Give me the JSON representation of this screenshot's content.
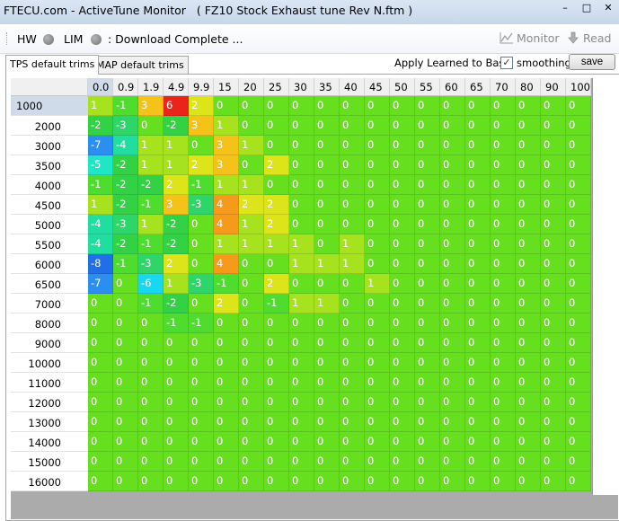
{
  "window": {
    "title": "FTECU.com - ActiveTune Monitor   ( FZ10 Stock Exhaust tune Rev N.ftm )",
    "minimize_glyph": "–",
    "maximize_glyph": "□",
    "close_glyph": "✕"
  },
  "toolbar": {
    "hw_label": "HW",
    "lim_label": "LIM",
    "status_text": ":  Download Complete  ...",
    "monitor_label": "Monitor",
    "read_label": "Read",
    "hw_led_icon": "status-led",
    "lim_led_icon": "status-led",
    "monitor_icon": "chart-line-icon",
    "read_icon": "download-arrow-icon"
  },
  "tabs": [
    {
      "label": "TPS default trims",
      "active": true
    },
    {
      "label": "MAP default trims",
      "active": false
    }
  ],
  "apply_learned_label": "Apply Learned to Base:",
  "smoothing": {
    "label": "smoothing",
    "checked": true,
    "check_glyph": "✓"
  },
  "save_label": "save",
  "colors": {
    "cell_green": "#66e01e",
    "header_selected": "#d0dbe9",
    "scale": {
      "-8": "#1e6fe8",
      "-7": "#2a8ff0",
      "-6": "#17d8f0",
      "-5": "#1fe6c4",
      "-4": "#20dea0",
      "-3": "#2ed66a",
      "-2": "#33d245",
      "-1": "#4edc2e",
      "0": "#66e01e",
      "1": "#a6e31e",
      "2": "#dde41a",
      "3": "#f5c21a",
      "4": "#f59a1a",
      "5": "#f06a1a",
      "6": "#ea2418"
    }
  },
  "table": {
    "columns": [
      "0.0",
      "0.9",
      "1.9",
      "4.9",
      "9.9",
      "15",
      "20",
      "25",
      "30",
      "35",
      "40",
      "45",
      "50",
      "55",
      "60",
      "65",
      "70",
      "80",
      "90",
      "100"
    ],
    "selected_column": 0,
    "selected_row": 0,
    "rows": [
      {
        "label": "1000",
        "values": [
          1,
          -1,
          3,
          6,
          2,
          0,
          0,
          0,
          0,
          0,
          0,
          0,
          0,
          0,
          0,
          0,
          0,
          0,
          0,
          0
        ]
      },
      {
        "label": "2000",
        "values": [
          -2,
          -3,
          0,
          -2,
          3,
          1,
          0,
          0,
          0,
          0,
          0,
          0,
          0,
          0,
          0,
          0,
          0,
          0,
          0,
          0
        ]
      },
      {
        "label": "3000",
        "values": [
          -7,
          -4,
          1,
          1,
          0,
          3,
          1,
          0,
          0,
          0,
          0,
          0,
          0,
          0,
          0,
          0,
          0,
          0,
          0,
          0
        ]
      },
      {
        "label": "3500",
        "values": [
          -5,
          -2,
          1,
          1,
          2,
          3,
          0,
          2,
          0,
          0,
          0,
          0,
          0,
          0,
          0,
          0,
          0,
          0,
          0,
          0
        ]
      },
      {
        "label": "4000",
        "values": [
          -1,
          -2,
          -2,
          2,
          -1,
          1,
          1,
          0,
          0,
          0,
          0,
          0,
          0,
          0,
          0,
          0,
          0,
          0,
          0,
          0
        ]
      },
      {
        "label": "4500",
        "values": [
          1,
          -2,
          -1,
          3,
          -3,
          4,
          2,
          2,
          0,
          0,
          0,
          0,
          0,
          0,
          0,
          0,
          0,
          0,
          0,
          0
        ]
      },
      {
        "label": "5000",
        "values": [
          -4,
          -3,
          1,
          -2,
          0,
          4,
          1,
          2,
          0,
          0,
          0,
          0,
          0,
          0,
          0,
          0,
          0,
          0,
          0,
          0
        ]
      },
      {
        "label": "5500",
        "values": [
          -4,
          -2,
          -1,
          -2,
          0,
          1,
          1,
          1,
          1,
          0,
          1,
          0,
          0,
          0,
          0,
          0,
          0,
          0,
          0,
          0
        ]
      },
      {
        "label": "6000",
        "values": [
          -8,
          -1,
          -3,
          2,
          0,
          4,
          0,
          0,
          1,
          1,
          1,
          0,
          0,
          0,
          0,
          0,
          0,
          0,
          0,
          0
        ]
      },
      {
        "label": "6500",
        "values": [
          -7,
          0,
          -6,
          1,
          -3,
          -1,
          0,
          2,
          0,
          0,
          0,
          1,
          0,
          0,
          0,
          0,
          0,
          0,
          0,
          0
        ]
      },
      {
        "label": "7000",
        "values": [
          0,
          0,
          -1,
          -2,
          0,
          2,
          0,
          -1,
          1,
          1,
          0,
          0,
          0,
          0,
          0,
          0,
          0,
          0,
          0,
          0
        ]
      },
      {
        "label": "8000",
        "values": [
          0,
          0,
          0,
          -1,
          -1,
          0,
          0,
          0,
          0,
          0,
          0,
          0,
          0,
          0,
          0,
          0,
          0,
          0,
          0,
          0
        ]
      },
      {
        "label": "9000",
        "values": [
          0,
          0,
          0,
          0,
          0,
          0,
          0,
          0,
          0,
          0,
          0,
          0,
          0,
          0,
          0,
          0,
          0,
          0,
          0,
          0
        ]
      },
      {
        "label": "10000",
        "values": [
          0,
          0,
          0,
          0,
          0,
          0,
          0,
          0,
          0,
          0,
          0,
          0,
          0,
          0,
          0,
          0,
          0,
          0,
          0,
          0
        ]
      },
      {
        "label": "11000",
        "values": [
          0,
          0,
          0,
          0,
          0,
          0,
          0,
          0,
          0,
          0,
          0,
          0,
          0,
          0,
          0,
          0,
          0,
          0,
          0,
          0
        ]
      },
      {
        "label": "12000",
        "values": [
          0,
          0,
          0,
          0,
          0,
          0,
          0,
          0,
          0,
          0,
          0,
          0,
          0,
          0,
          0,
          0,
          0,
          0,
          0,
          0
        ]
      },
      {
        "label": "13000",
        "values": [
          0,
          0,
          0,
          0,
          0,
          0,
          0,
          0,
          0,
          0,
          0,
          0,
          0,
          0,
          0,
          0,
          0,
          0,
          0,
          0
        ]
      },
      {
        "label": "14000",
        "values": [
          0,
          0,
          0,
          0,
          0,
          0,
          0,
          0,
          0,
          0,
          0,
          0,
          0,
          0,
          0,
          0,
          0,
          0,
          0,
          0
        ]
      },
      {
        "label": "15000",
        "values": [
          0,
          0,
          0,
          0,
          0,
          0,
          0,
          0,
          0,
          0,
          0,
          0,
          0,
          0,
          0,
          0,
          0,
          0,
          0,
          0
        ]
      },
      {
        "label": "16000",
        "values": [
          0,
          0,
          0,
          0,
          0,
          0,
          0,
          0,
          0,
          0,
          0,
          0,
          0,
          0,
          0,
          0,
          0,
          0,
          0,
          0
        ]
      }
    ]
  }
}
